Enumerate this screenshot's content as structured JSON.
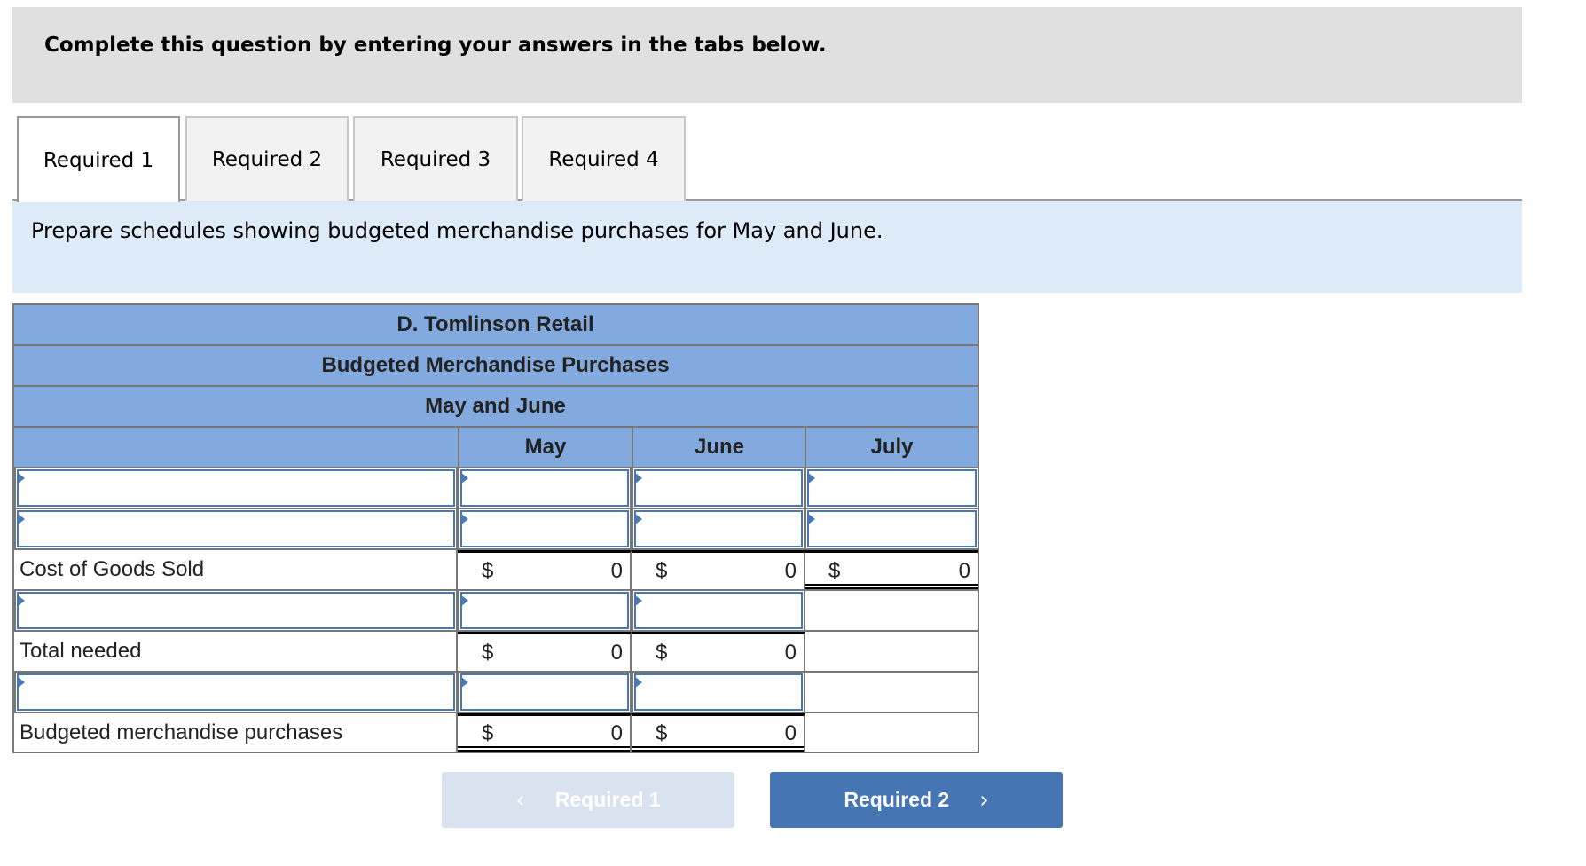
{
  "header": {
    "title": "Complete this question by entering your answers in the tabs below."
  },
  "tabs": [
    {
      "label": "Required 1",
      "active": true
    },
    {
      "label": "Required 2",
      "active": false
    },
    {
      "label": "Required 3",
      "active": false
    },
    {
      "label": "Required 4",
      "active": false
    }
  ],
  "instructions": "Prepare schedules showing budgeted merchandise purchases for May and June.",
  "schedule": {
    "company": "D. Tomlinson Retail",
    "title": "Budgeted Merchandise Purchases",
    "period": "May and June",
    "columns": [
      "May",
      "June",
      "July"
    ],
    "rows": [
      {
        "type": "input",
        "label": "",
        "values": [
          "",
          "",
          ""
        ]
      },
      {
        "type": "input",
        "label": "",
        "values": [
          "",
          "",
          ""
        ]
      },
      {
        "type": "total",
        "label": "Cost of Goods Sold",
        "currency": "$",
        "values": [
          "0",
          "0",
          "0"
        ]
      },
      {
        "type": "input",
        "label": "",
        "values": [
          "",
          ""
        ]
      },
      {
        "type": "total",
        "label": "Total needed",
        "currency": "$",
        "values": [
          "0",
          "0"
        ]
      },
      {
        "type": "input",
        "label": "",
        "values": [
          "",
          ""
        ]
      },
      {
        "type": "total",
        "label": "Budgeted merchandise purchases",
        "currency": "$",
        "values": [
          "0",
          "0"
        ]
      }
    ]
  },
  "navigation": {
    "prev_label": "Required 1",
    "prev_icon": "chevron-left-icon",
    "prev_enabled": false,
    "next_label": "Required 2",
    "next_icon": "chevron-right-icon",
    "next_enabled": true
  },
  "colors": {
    "header_band": "#e0e0e0",
    "info_band": "#ddebf8",
    "table_header": "#82aadf",
    "input_border": "#4a78b5",
    "next_button": "#4575b3",
    "prev_button_disabled": "#d9e3f0"
  }
}
